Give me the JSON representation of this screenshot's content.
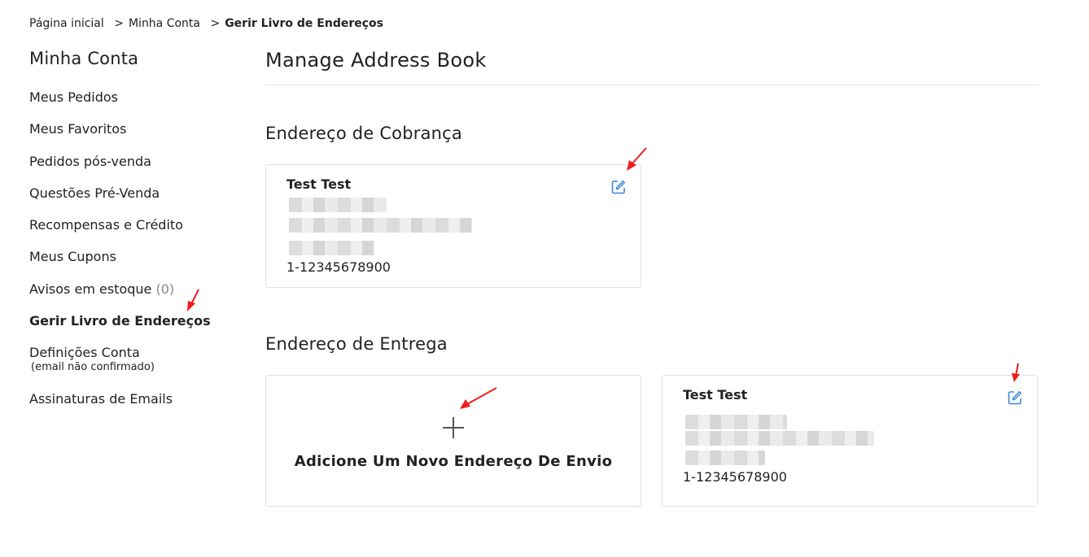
{
  "breadcrumb": {
    "home": "Página inicial",
    "account": "Minha Conta",
    "current": "Gerir Livro de Endereços",
    "separator": ">"
  },
  "sidebar": {
    "title": "Minha Conta",
    "items": [
      {
        "label": "Meus Pedidos"
      },
      {
        "label": "Meus Favoritos"
      },
      {
        "label": "Pedidos pós-venda"
      },
      {
        "label": "Questões Pré-Venda"
      },
      {
        "label": "Recompensas e Crédito"
      },
      {
        "label": "Meus Cupons"
      },
      {
        "label": "Avisos em estoque",
        "count": "(0)"
      },
      {
        "label": "Gerir Livro de Endereços"
      },
      {
        "label": "Definições Conta",
        "sub": "(email não confirmado)"
      },
      {
        "label": "Assinaturas de Emails"
      }
    ]
  },
  "main": {
    "title": "Manage Address Book",
    "billing": {
      "title": "Endereço de Cobrança",
      "name": "Test Test",
      "phone": "1-12345678900"
    },
    "shipping": {
      "title": "Endereço de Entrega",
      "add_label": "Adicione Um Novo Endereço De Envio",
      "address": {
        "name": "Test Test",
        "phone": "1-12345678900"
      }
    }
  },
  "colors": {
    "accent_blue": "#3a86d8",
    "annotation_red": "#ee1c1c",
    "border": "#e3e3e3"
  },
  "icons": [
    "edit-icon",
    "plus-icon"
  ]
}
